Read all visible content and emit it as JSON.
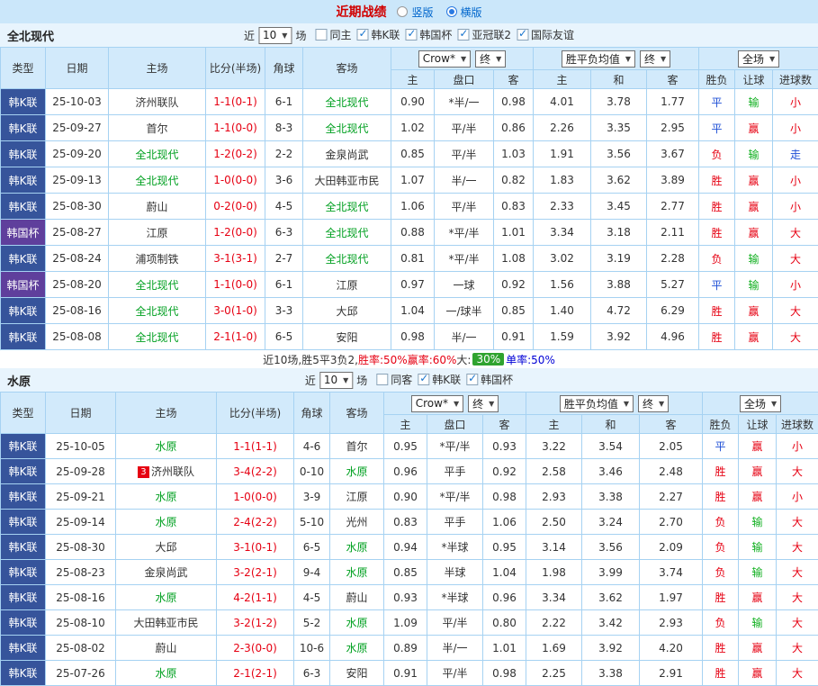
{
  "topbar": {
    "title": "近期战绩",
    "radios": [
      {
        "label": "竖版",
        "checked": false
      },
      {
        "label": "横版",
        "checked": true
      }
    ]
  },
  "sections": [
    {
      "team": "全北现代",
      "filter": {
        "prefix": "近",
        "count": "10",
        "suffix": "场",
        "checkboxes": [
          {
            "label": "同主",
            "checked": false
          },
          {
            "label": "韩K联",
            "checked": true
          },
          {
            "label": "韩国杯",
            "checked": true
          },
          {
            "label": "亚冠联2",
            "checked": true
          },
          {
            "label": "国际友谊",
            "checked": true
          }
        ]
      },
      "columns": {
        "type": "类型",
        "date": "日期",
        "home": "主场",
        "score": "比分(半场)",
        "corner": "角球",
        "away": "客场",
        "odds_select": "Crow*",
        "odds_final_select": "终",
        "avg_select": "胜平负均值",
        "avg_final_select": "终",
        "result_select": "全场",
        "odds_home": "主",
        "odds_line": "盘口",
        "odds_away": "客",
        "avg_home": "主",
        "avg_draw": "和",
        "avg_away": "客",
        "res_wdl": "胜负",
        "res_handicap": "让球",
        "res_goals": "进球数"
      },
      "rows": [
        {
          "type": "韩K联",
          "date": "25-10-03",
          "home": "济州联队",
          "score": "1-1(0-1)",
          "corner": "6-1",
          "away": "全北现代",
          "away_self": true,
          "odds": [
            "0.90",
            "*半/一",
            "0.98"
          ],
          "avg": [
            "4.01",
            "3.78",
            "1.77"
          ],
          "results": [
            "平",
            "输",
            "小"
          ]
        },
        {
          "type": "韩K联",
          "date": "25-09-27",
          "home": "首尔",
          "score": "1-1(0-0)",
          "corner": "8-3",
          "away": "全北现代",
          "away_self": true,
          "odds": [
            "1.02",
            "平/半",
            "0.86"
          ],
          "avg": [
            "2.26",
            "3.35",
            "2.95"
          ],
          "results": [
            "平",
            "赢",
            "小"
          ]
        },
        {
          "type": "韩K联",
          "date": "25-09-20",
          "home": "全北现代",
          "home_self": true,
          "score": "1-2(0-2)",
          "corner": "2-2",
          "away": "金泉尚武",
          "odds": [
            "0.85",
            "平/半",
            "1.03"
          ],
          "avg": [
            "1.91",
            "3.56",
            "3.67"
          ],
          "results": [
            "负",
            "输",
            "走"
          ]
        },
        {
          "type": "韩K联",
          "date": "25-09-13",
          "home": "全北现代",
          "home_self": true,
          "score": "1-0(0-0)",
          "corner": "3-6",
          "away": "大田韩亚市民",
          "odds": [
            "1.07",
            "半/一",
            "0.82"
          ],
          "avg": [
            "1.83",
            "3.62",
            "3.89"
          ],
          "results": [
            "胜",
            "赢",
            "小"
          ]
        },
        {
          "type": "韩K联",
          "date": "25-08-30",
          "home": "蔚山",
          "score": "0-2(0-0)",
          "corner": "4-5",
          "away": "全北现代",
          "away_self": true,
          "odds": [
            "1.06",
            "平/半",
            "0.83"
          ],
          "avg": [
            "2.33",
            "3.45",
            "2.77"
          ],
          "results": [
            "胜",
            "赢",
            "小"
          ]
        },
        {
          "type": "韩国杯",
          "date": "25-08-27",
          "home": "江原",
          "score": "1-2(0-0)",
          "corner": "6-3",
          "away": "全北现代",
          "away_self": true,
          "odds": [
            "0.88",
            "*平/半",
            "1.01"
          ],
          "avg": [
            "3.34",
            "3.18",
            "2.11"
          ],
          "results": [
            "胜",
            "赢",
            "大"
          ]
        },
        {
          "type": "韩K联",
          "date": "25-08-24",
          "home": "浦项制铁",
          "score": "3-1(3-1)",
          "corner": "2-7",
          "away": "全北现代",
          "away_self": true,
          "odds": [
            "0.81",
            "*平/半",
            "1.08"
          ],
          "avg": [
            "3.02",
            "3.19",
            "2.28"
          ],
          "results": [
            "负",
            "输",
            "大"
          ]
        },
        {
          "type": "韩国杯",
          "date": "25-08-20",
          "home": "全北现代",
          "home_self": true,
          "score": "1-1(0-0)",
          "corner": "6-1",
          "away": "江原",
          "odds": [
            "0.97",
            "一球",
            "0.92"
          ],
          "avg": [
            "1.56",
            "3.88",
            "5.27"
          ],
          "results": [
            "平",
            "输",
            "小"
          ]
        },
        {
          "type": "韩K联",
          "date": "25-08-16",
          "home": "全北现代",
          "home_self": true,
          "score": "3-0(1-0)",
          "corner": "3-3",
          "away": "大邱",
          "odds": [
            "1.04",
            "一/球半",
            "0.85"
          ],
          "avg": [
            "1.40",
            "4.72",
            "6.29"
          ],
          "results": [
            "胜",
            "赢",
            "大"
          ]
        },
        {
          "type": "韩K联",
          "date": "25-08-08",
          "home": "全北现代",
          "home_self": true,
          "score": "2-1(1-0)",
          "corner": "6-5",
          "away": "安阳",
          "odds": [
            "0.98",
            "半/一",
            "0.91"
          ],
          "avg": [
            "1.59",
            "3.92",
            "4.96"
          ],
          "results": [
            "胜",
            "赢",
            "大"
          ]
        }
      ],
      "summary_parts": [
        {
          "text": "近10场,胜5平3负2, ",
          "style": "plain"
        },
        {
          "text": "胜率:50% ",
          "style": "red"
        },
        {
          "text": "赢率:60% ",
          "style": "red"
        },
        {
          "text": "大:",
          "style": "plain"
        },
        {
          "text": "30%",
          "style": "green-badge"
        },
        {
          "text": " 单率:50%",
          "style": "blue"
        }
      ]
    },
    {
      "team": "水原",
      "filter": {
        "prefix": "近",
        "count": "10",
        "suffix": "场",
        "checkboxes": [
          {
            "label": "同客",
            "checked": false
          },
          {
            "label": "韩K联",
            "checked": true
          },
          {
            "label": "韩国杯",
            "checked": true
          }
        ]
      },
      "columns": {
        "type": "类型",
        "date": "日期",
        "home": "主场",
        "score": "比分(半场)",
        "corner": "角球",
        "away": "客场",
        "odds_select": "Crow*",
        "odds_final_select": "终",
        "avg_select": "胜平负均值",
        "avg_final_select": "终",
        "result_select": "全场",
        "odds_home": "主",
        "odds_line": "盘口",
        "odds_away": "客",
        "avg_home": "主",
        "avg_draw": "和",
        "avg_away": "客",
        "res_wdl": "胜负",
        "res_handicap": "让球",
        "res_goals": "进球数"
      },
      "rows": [
        {
          "type": "韩K联",
          "date": "25-10-05",
          "home": "水原",
          "home_self": true,
          "score": "1-1(1-1)",
          "corner": "4-6",
          "away": "首尔",
          "odds": [
            "0.95",
            "*平/半",
            "0.93"
          ],
          "avg": [
            "3.22",
            "3.54",
            "2.05"
          ],
          "results": [
            "平",
            "赢",
            "小"
          ]
        },
        {
          "type": "韩K联",
          "date": "25-09-28",
          "home": "济州联队",
          "home_badge": "3",
          "score": "3-4(2-2)",
          "corner": "0-10",
          "away": "水原",
          "away_self": true,
          "odds": [
            "0.96",
            "平手",
            "0.92"
          ],
          "avg": [
            "2.58",
            "3.46",
            "2.48"
          ],
          "results": [
            "胜",
            "赢",
            "大"
          ]
        },
        {
          "type": "韩K联",
          "date": "25-09-21",
          "home": "水原",
          "home_self": true,
          "score": "1-0(0-0)",
          "corner": "3-9",
          "away": "江原",
          "odds": [
            "0.90",
            "*平/半",
            "0.98"
          ],
          "avg": [
            "2.93",
            "3.38",
            "2.27"
          ],
          "results": [
            "胜",
            "赢",
            "小"
          ]
        },
        {
          "type": "韩K联",
          "date": "25-09-14",
          "home": "水原",
          "home_self": true,
          "score": "2-4(2-2)",
          "corner": "5-10",
          "away": "光州",
          "odds": [
            "0.83",
            "平手",
            "1.06"
          ],
          "avg": [
            "2.50",
            "3.24",
            "2.70"
          ],
          "results": [
            "负",
            "输",
            "大"
          ]
        },
        {
          "type": "韩K联",
          "date": "25-08-30",
          "home": "大邱",
          "score": "3-1(0-1)",
          "corner": "6-5",
          "away": "水原",
          "away_self": true,
          "odds": [
            "0.94",
            "*半球",
            "0.95"
          ],
          "avg": [
            "3.14",
            "3.56",
            "2.09"
          ],
          "results": [
            "负",
            "输",
            "大"
          ]
        },
        {
          "type": "韩K联",
          "date": "25-08-23",
          "home": "金泉尚武",
          "score": "3-2(2-1)",
          "corner": "9-4",
          "away": "水原",
          "away_self": true,
          "odds": [
            "0.85",
            "半球",
            "1.04"
          ],
          "avg": [
            "1.98",
            "3.99",
            "3.74"
          ],
          "results": [
            "负",
            "输",
            "大"
          ]
        },
        {
          "type": "韩K联",
          "date": "25-08-16",
          "home": "水原",
          "home_self": true,
          "score": "4-2(1-1)",
          "corner": "4-5",
          "away": "蔚山",
          "odds": [
            "0.93",
            "*半球",
            "0.96"
          ],
          "avg": [
            "3.34",
            "3.62",
            "1.97"
          ],
          "results": [
            "胜",
            "赢",
            "大"
          ]
        },
        {
          "type": "韩K联",
          "date": "25-08-10",
          "home": "大田韩亚市民",
          "score": "3-2(1-2)",
          "corner": "5-2",
          "away": "水原",
          "away_self": true,
          "odds": [
            "1.09",
            "平/半",
            "0.80"
          ],
          "avg": [
            "2.22",
            "3.42",
            "2.93"
          ],
          "results": [
            "负",
            "输",
            "大"
          ]
        },
        {
          "type": "韩K联",
          "date": "25-08-02",
          "home": "蔚山",
          "score": "2-3(0-0)",
          "corner": "10-6",
          "away": "水原",
          "away_self": true,
          "odds": [
            "0.89",
            "半/一",
            "1.01"
          ],
          "avg": [
            "1.69",
            "3.92",
            "4.20"
          ],
          "results": [
            "胜",
            "赢",
            "大"
          ]
        },
        {
          "type": "韩K联",
          "date": "25-07-26",
          "home": "水原",
          "home_self": true,
          "score": "2-1(2-1)",
          "corner": "6-3",
          "away": "安阳",
          "odds": [
            "0.91",
            "平/半",
            "0.98"
          ],
          "avg": [
            "2.25",
            "3.38",
            "2.91"
          ],
          "results": [
            "胜",
            "赢",
            "大"
          ]
        }
      ]
    }
  ]
}
